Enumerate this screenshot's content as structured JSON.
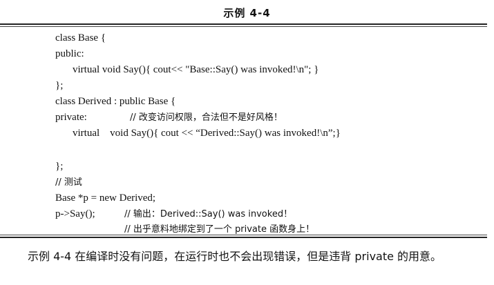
{
  "example": {
    "title": "示例 4-4"
  },
  "code": {
    "l1": "class Base {",
    "l2": "public:",
    "l3": "virtual void Say(){ cout<< \"Base::Say() was invoked!\\n\"; }",
    "l4": "};",
    "l5": "class Derived : public Base {",
    "l6_kw": "private:",
    "l6_comment": "// 改变访问权限，合法但不是好风格！",
    "l7": "virtual    void Say(){ cout << “Derived::Say() was invoked!\\n”;}",
    "l8": "};",
    "l9": "// 测试",
    "l10": "Base *p = new Derived;",
    "l11_code": "p->Say();",
    "l11_comment": "// 输出：Derived::Say() was invoked！",
    "l12_comment": "// 出乎意料地绑定到了一个 private 函数身上！"
  },
  "paragraph": {
    "text": "示例 4-4 在编译时没有问题，在运行时也不会出现错误，但是违背 private 的用意。"
  }
}
